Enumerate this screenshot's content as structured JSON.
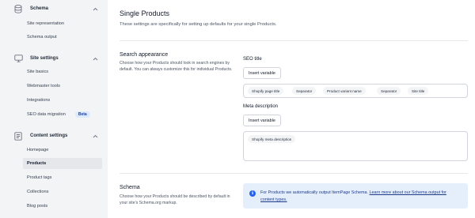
{
  "sidebar": {
    "schema": {
      "title": "Schema",
      "items": [
        "Site representation",
        "Schema output"
      ]
    },
    "site_settings": {
      "title": "Site settings",
      "items": [
        "Site basics",
        "Webmaster tools",
        "Integrations",
        "SEO data migration"
      ],
      "badge": "Beta"
    },
    "content_settings": {
      "title": "Content settings",
      "items": [
        "Homepage",
        "Products",
        "Product tags",
        "Collections",
        "Blog posts"
      ],
      "active_item": "Products"
    }
  },
  "main": {
    "title": "Single Products",
    "description": "These settings are specifically for setting up defaults for your single Products.",
    "search_appearance": {
      "title": "Search appearance",
      "description": "Choose how your Products should look in search engines by default. You can always customize this for individual Products.",
      "seo_title": {
        "label": "SEO title",
        "insert_variable": "Insert variable",
        "chips": [
          "Shopify page title",
          "Separator",
          "Product variant name",
          "Separator",
          "Site title"
        ]
      },
      "meta_description": {
        "label": "Meta description",
        "insert_variable": "Insert variable",
        "chips": [
          "Shopify meta description"
        ]
      }
    },
    "schema": {
      "title": "Schema",
      "description": "Choose how your Products should be described by default in your site's Schema.org markup.",
      "info_text": "For Products we automatically output ItemPage Schema. ",
      "info_link": "Learn more about our Schema output for content types."
    }
  },
  "colors": {
    "sidebar_bg": "#f3f4f6",
    "active_bg": "#e5e7eb",
    "badge_bg": "#dbeafe",
    "info_bg": "#e5effc",
    "accent": "#2563eb"
  }
}
